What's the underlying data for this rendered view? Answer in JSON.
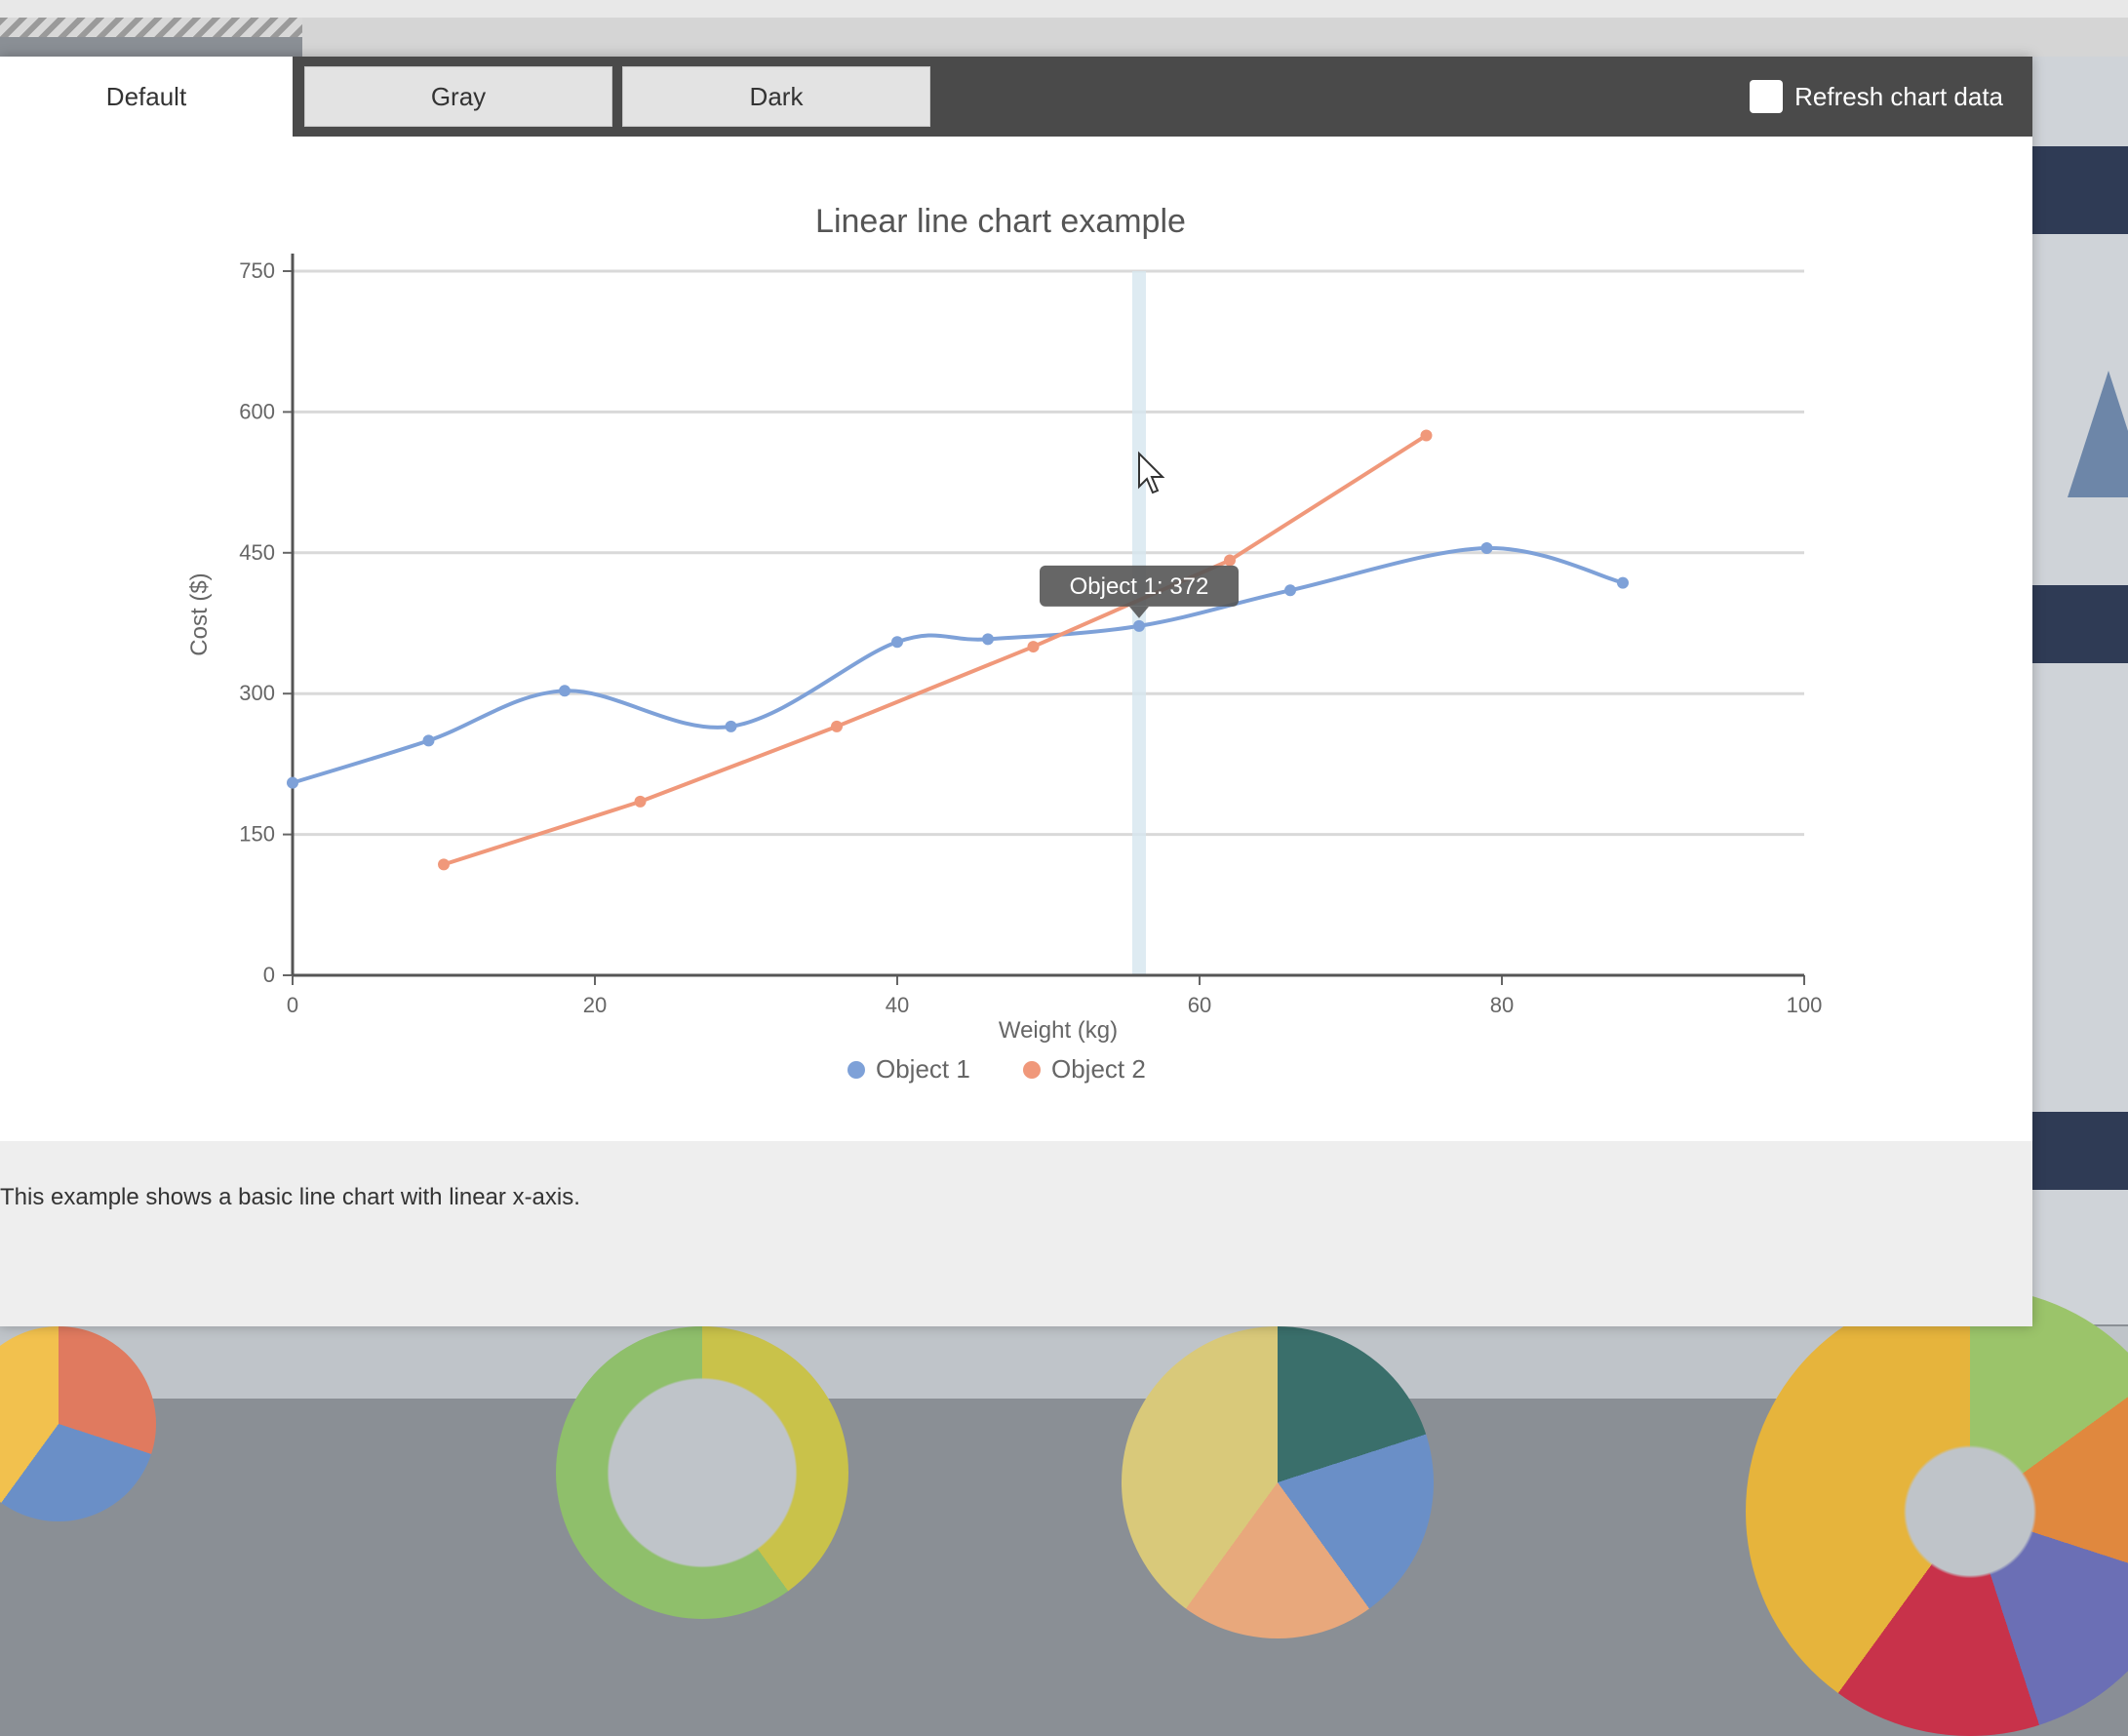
{
  "tabs": [
    {
      "label": "Default",
      "active": true
    },
    {
      "label": "Gray",
      "active": false
    },
    {
      "label": "Dark",
      "active": false
    }
  ],
  "toolbar": {
    "refresh_label": "Refresh chart data",
    "refresh_checked": false
  },
  "tooltip": {
    "text": "Object 1: 372",
    "x": 56
  },
  "caption": "This example shows a basic line chart with linear x-axis.",
  "colors": {
    "object1": "#7ea1d8",
    "object2": "#f0987a",
    "tab_bar": "#4a4a4a",
    "crosshair": "#d6e6ef"
  },
  "chart_data": {
    "type": "line",
    "title": "Linear line chart example",
    "xlabel": "Weight (kg)",
    "ylabel": "Cost ($)",
    "xlim": [
      0,
      100
    ],
    "ylim": [
      0,
      750
    ],
    "x_ticks": [
      0,
      20,
      40,
      60,
      80,
      100
    ],
    "y_ticks": [
      0,
      150,
      300,
      450,
      600,
      750
    ],
    "grid": true,
    "legend_position": "bottom",
    "series": [
      {
        "name": "Object 1",
        "color": "#7ea1d8",
        "points": [
          {
            "x": 0,
            "y": 205
          },
          {
            "x": 9,
            "y": 250
          },
          {
            "x": 18,
            "y": 303
          },
          {
            "x": 29,
            "y": 265
          },
          {
            "x": 40,
            "y": 355
          },
          {
            "x": 46,
            "y": 358
          },
          {
            "x": 56,
            "y": 372
          },
          {
            "x": 66,
            "y": 410
          },
          {
            "x": 79,
            "y": 455
          },
          {
            "x": 88,
            "y": 418
          }
        ]
      },
      {
        "name": "Object 2",
        "color": "#f0987a",
        "points": [
          {
            "x": 10,
            "y": 118
          },
          {
            "x": 23,
            "y": 185
          },
          {
            "x": 36,
            "y": 265
          },
          {
            "x": 49,
            "y": 350
          },
          {
            "x": 62,
            "y": 442
          },
          {
            "x": 75,
            "y": 575
          }
        ]
      }
    ]
  }
}
